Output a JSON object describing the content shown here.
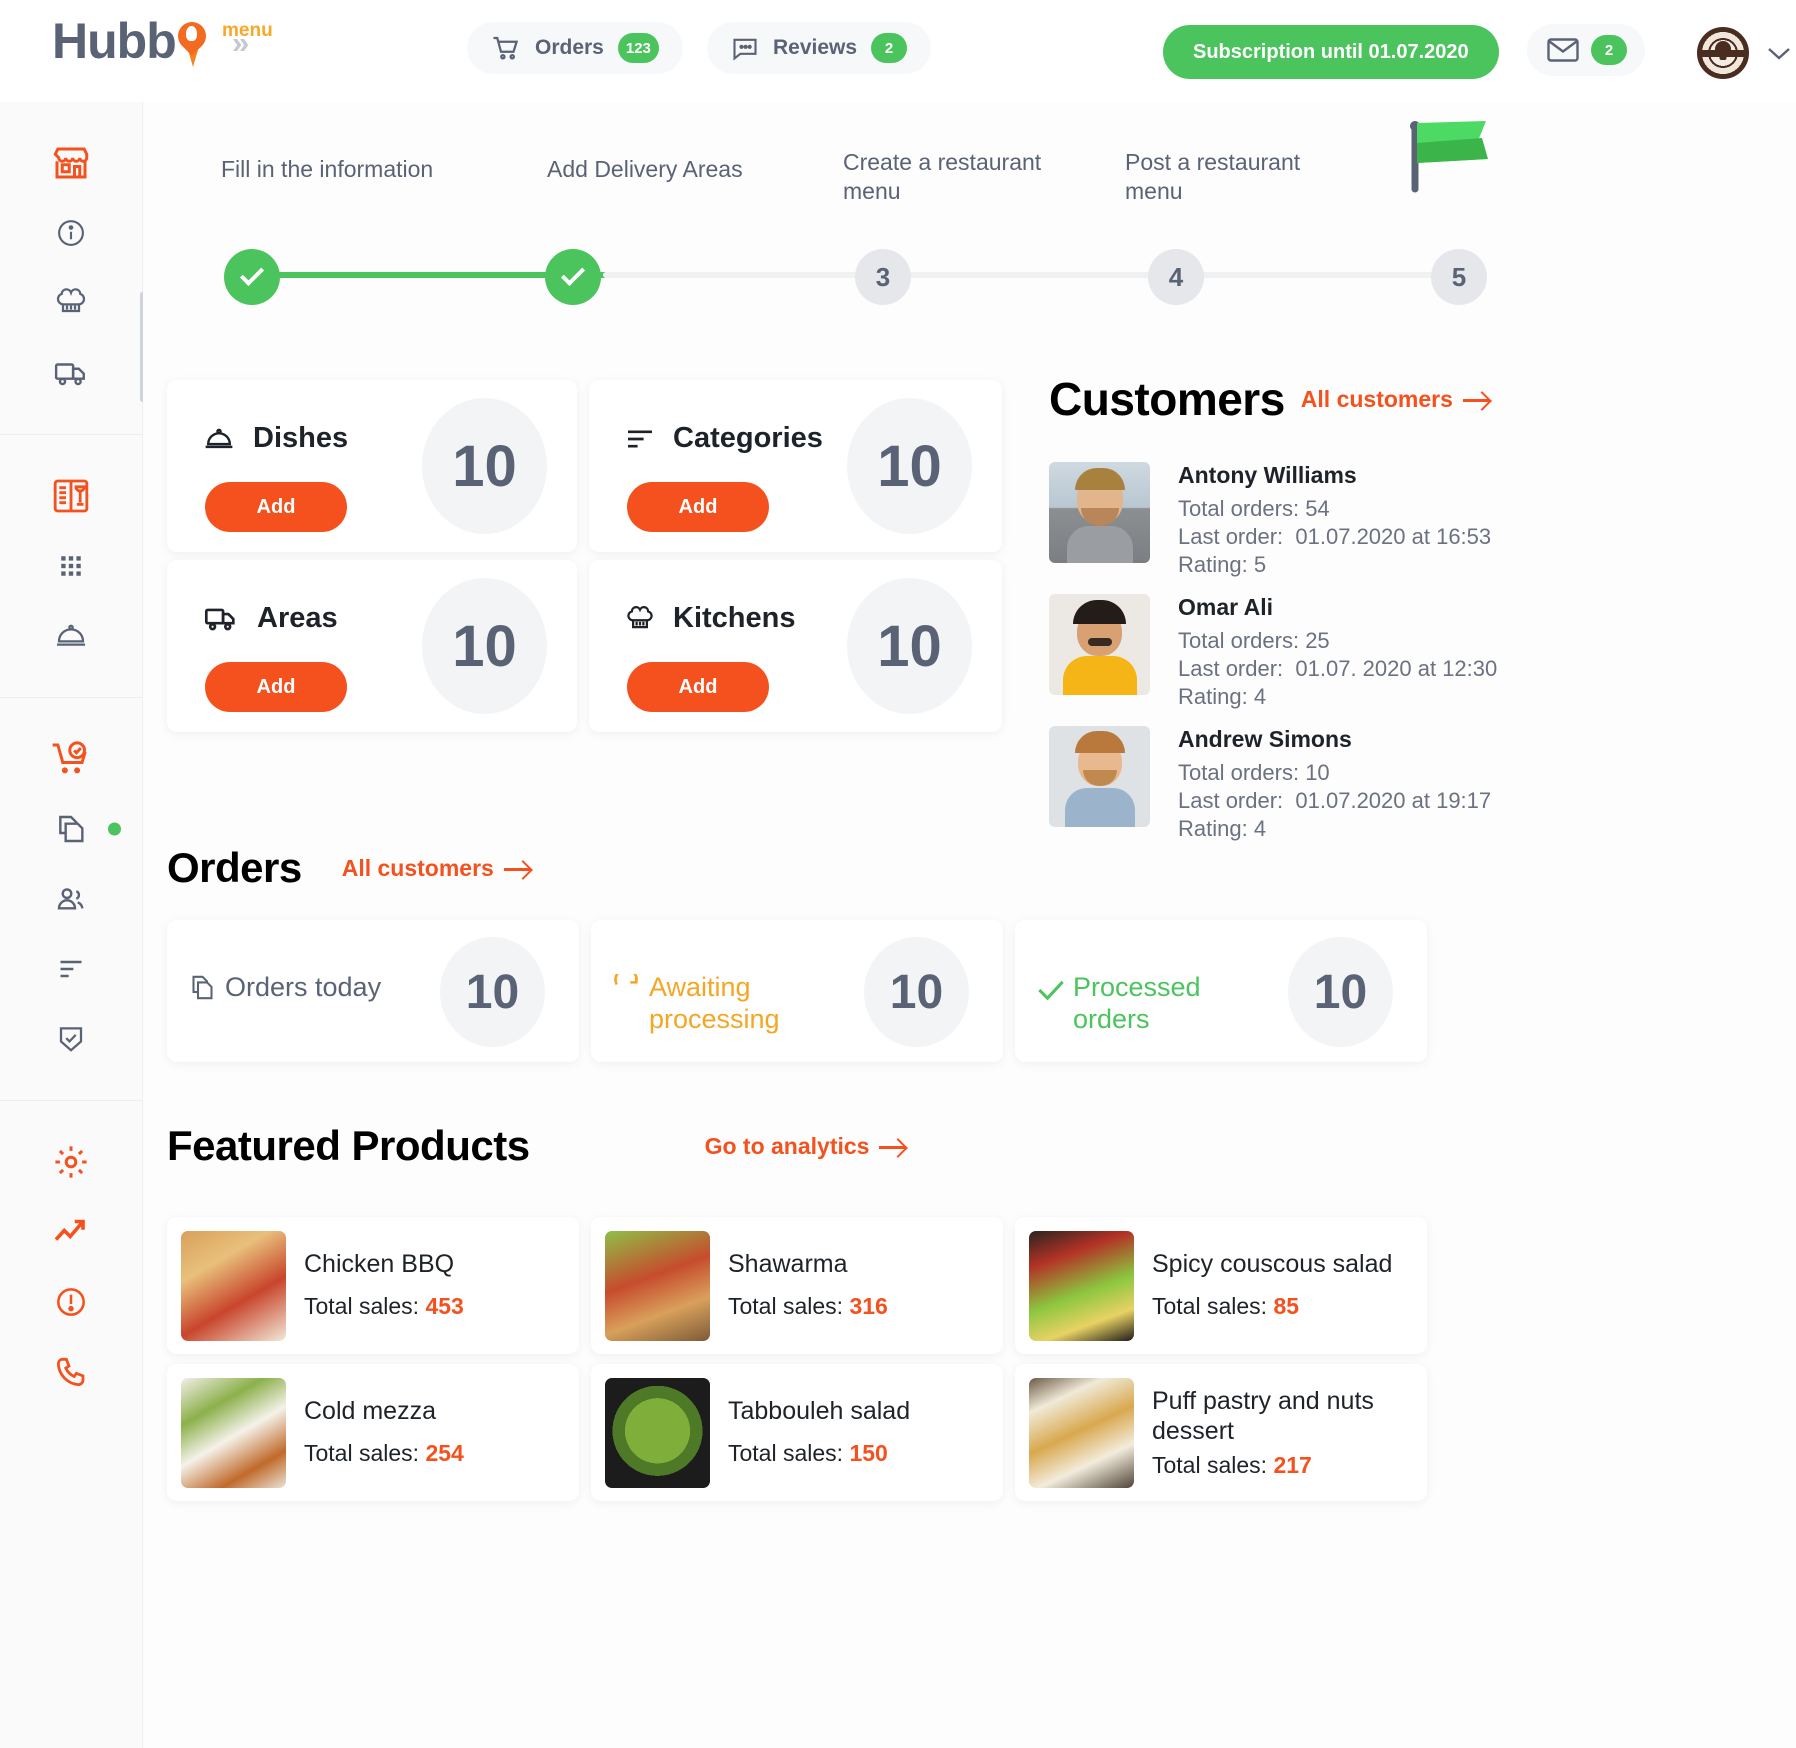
{
  "header": {
    "logo_text": "Hubb",
    "logo_badge": "menu",
    "collapse_icon": "chevron-double-right-icon",
    "orders": {
      "label": "Orders",
      "count": "123",
      "icon": "cart-icon"
    },
    "reviews": {
      "label": "Reviews",
      "count": "2",
      "icon": "comment-icon"
    },
    "subscription_label": "Subscription until 01.07.2020",
    "mail": {
      "icon": "envelope-icon",
      "count": "2"
    },
    "avatar_name": "restaurant-logo-avatar",
    "accent_orange": "#f4511e",
    "accent_green": "#4cc45e"
  },
  "sidebar": {
    "items": [
      {
        "name": "storefront",
        "icon": "store-icon",
        "active": true
      },
      {
        "name": "information",
        "icon": "info-circle-icon",
        "active": false
      },
      {
        "name": "kitchens",
        "icon": "chef-hat-icon",
        "active": false
      },
      {
        "name": "delivery",
        "icon": "truck-icon",
        "active": false
      },
      {
        "name": "menu-book",
        "icon": "menu-book-icon",
        "active": true
      },
      {
        "name": "categories-grid",
        "icon": "grid-dots-icon",
        "active": false
      },
      {
        "name": "dishes",
        "icon": "dish-cloche-icon",
        "active": false
      },
      {
        "name": "orders-cart",
        "icon": "cart-check-icon",
        "active": true
      },
      {
        "name": "documents",
        "icon": "copy-files-icon",
        "active": false,
        "dot": true
      },
      {
        "name": "customers",
        "icon": "users-icon",
        "active": false
      },
      {
        "name": "lists",
        "icon": "align-left-icon",
        "active": false
      },
      {
        "name": "security",
        "icon": "shield-check-icon",
        "active": false
      },
      {
        "name": "settings",
        "icon": "gear-icon",
        "active": true
      },
      {
        "name": "analytics",
        "icon": "trending-up-icon",
        "active": true
      },
      {
        "name": "alerts",
        "icon": "exclamation-circle-icon",
        "active": true
      },
      {
        "name": "support-call",
        "icon": "phone-icon",
        "active": true
      }
    ]
  },
  "stepper": {
    "steps": [
      {
        "label": "Fill in the information",
        "marker": "✓",
        "done": true
      },
      {
        "label": "Add Delivery Areas",
        "marker": "✓",
        "done": true
      },
      {
        "label": "Create a restaurant menu",
        "marker": "3",
        "done": false
      },
      {
        "label": "Post a restaurant menu",
        "marker": "4",
        "done": false
      },
      {
        "label": "",
        "marker": "5",
        "done": false
      }
    ],
    "flag_icon": "green-flag-icon"
  },
  "stats": {
    "add_label": "Add",
    "cards": [
      {
        "title": "Dishes",
        "icon": "dish-cloche-icon",
        "value": "10"
      },
      {
        "title": "Categories",
        "icon": "align-left-icon",
        "value": "10"
      },
      {
        "title": "Areas",
        "icon": "truck-icon",
        "value": "10"
      },
      {
        "title": "Kitchens",
        "icon": "chef-hat-icon",
        "value": "10"
      }
    ]
  },
  "customers": {
    "title": "Customers",
    "all_link": "All customers",
    "labels": {
      "total_orders": "Total orders:",
      "last_order": "Last order:",
      "rating": "Rating:"
    },
    "list": [
      {
        "name": "Antony Williams",
        "total_orders": "54",
        "last_order": "01.07.2020 at 16:53",
        "rating": "5",
        "photo": "man-grey-sweater-photo"
      },
      {
        "name": "Omar Ali",
        "total_orders": "25",
        "last_order": "01.07. 2020 at 12:30",
        "rating": "4",
        "photo": "man-yellow-shirt-photo"
      },
      {
        "name": "Andrew Simons",
        "total_orders": "10",
        "last_order": "01.07.2020 at 19:17",
        "rating": "4",
        "photo": "man-denim-shirt-photo"
      }
    ]
  },
  "orders": {
    "title": "Orders",
    "all_link": "All customers",
    "cards": [
      {
        "title": "Orders today",
        "value": "10",
        "icon": "copy-files-icon",
        "color": "#5a6275"
      },
      {
        "title": "Awaiting processing",
        "value": "10",
        "icon": "refresh-icon",
        "color": "#f5a623"
      },
      {
        "title": "Processed orders",
        "value": "10",
        "icon": "check-icon",
        "color": "#4cc45e"
      }
    ]
  },
  "featured": {
    "title": "Featured Products",
    "analytics_link": "Go to analytics",
    "sales_label": "Total sales:",
    "products": [
      {
        "name": "Chicken BBQ",
        "sales": "453",
        "image": "chicken-bbq-photo"
      },
      {
        "name": "Shawarma",
        "sales": "316",
        "image": "shawarma-photo"
      },
      {
        "name": "Spicy couscous salad",
        "sales": "85",
        "image": "couscous-salad-photo"
      },
      {
        "name": "Cold mezza",
        "sales": "254",
        "image": "cold-mezza-photo"
      },
      {
        "name": "Tabbouleh salad",
        "sales": "150",
        "image": "tabbouleh-salad-photo"
      },
      {
        "name": "Puff pastry and nuts dessert",
        "sales": "217",
        "image": "puff-pastry-photo"
      }
    ]
  }
}
